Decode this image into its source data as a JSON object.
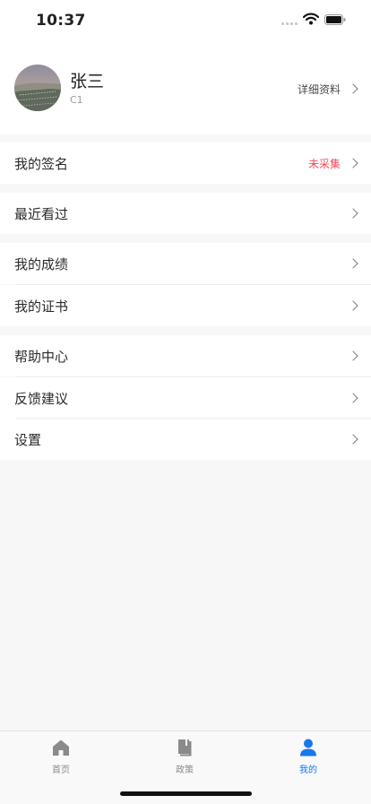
{
  "status_bar": {
    "time": "10:37"
  },
  "profile": {
    "name": "张三",
    "level": "C1",
    "detail_label": "详细资料"
  },
  "menu": {
    "signature": {
      "label": "我的签名",
      "status": "未采集"
    },
    "recent": {
      "label": "最近看过"
    },
    "grades": {
      "label": "我的成绩"
    },
    "certificates": {
      "label": "我的证书"
    },
    "help": {
      "label": "帮助中心"
    },
    "feedback": {
      "label": "反馈建议"
    },
    "settings": {
      "label": "设置"
    }
  },
  "tab_bar": {
    "tabs": [
      {
        "label": "首页",
        "icon": "home-icon",
        "active": false
      },
      {
        "label": "政策",
        "icon": "book-icon",
        "active": false
      },
      {
        "label": "我的",
        "icon": "person-icon",
        "active": true
      }
    ]
  },
  "colors": {
    "accent": "#1677f0",
    "status_red": "#f04a5d",
    "page_bg": "#f7f7f7"
  }
}
